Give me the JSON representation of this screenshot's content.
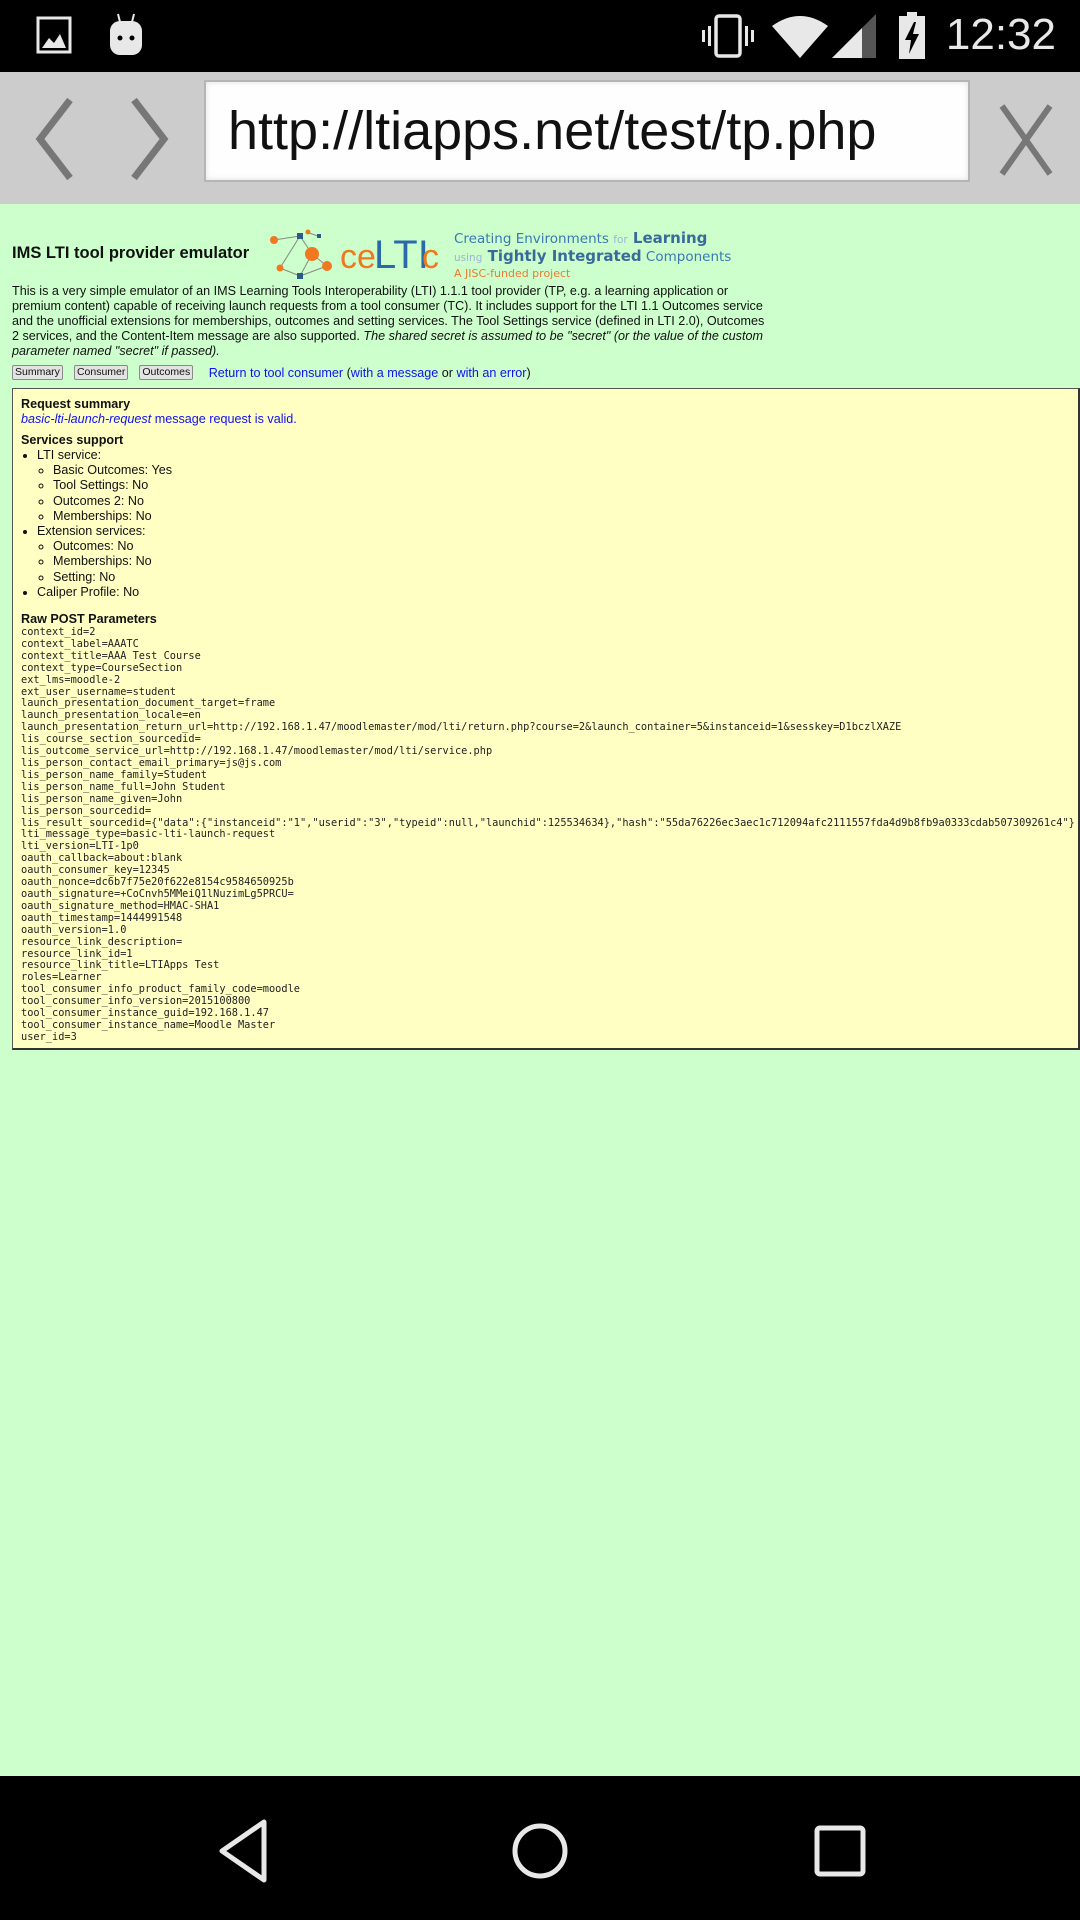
{
  "status_bar": {
    "left_icons": [
      "image-notification-icon",
      "android-notification-icon"
    ],
    "right_icons": [
      "vibrate-icon",
      "wifi-icon",
      "cell-signal-icon",
      "battery-charging-icon"
    ],
    "time": "12:32"
  },
  "browser": {
    "back_icon": "chevron-left-icon",
    "forward_icon": "chevron-right-icon",
    "url": "http://ltiapps.net/test/tp.php",
    "close_icon": "close-icon"
  },
  "page": {
    "title": "IMS LTI tool provider emulator",
    "logo": {
      "name": "ceLTIc",
      "tagline_line1_a": "Creating Environments ",
      "tagline_line1_b": "for",
      "tagline_line1_c": " Learning",
      "tagline_line2_a": "using",
      "tagline_line2_b": " Tightly Integrated",
      "tagline_line2_c": " Components",
      "tagline_line3": "A JISC-funded project"
    },
    "intro_text": "This is a very simple emulator of an IMS Learning Tools Interoperability (LTI) 1.1.1 tool provider (TP, e.g. a learning application or premium content) capable of receiving launch requests from a tool consumer (TC). It includes support for the LTI 1.1 Outcomes service and the unofficial extensions for memberships, outcomes and setting services. The Tool Settings service (defined in LTI 2.0), Outcomes 2 services, and the Content-Item message are also supported. ",
    "intro_italic": "The shared secret is assumed to be \"secret\" (or the value of the custom parameter named \"secret\" if passed).",
    "buttons": {
      "summary": "Summary",
      "consumer": "Consumer",
      "outcomes": "Outcomes"
    },
    "return_link": "Return to tool consumer",
    "paren_open": " (",
    "with_message_link": "with a message",
    "or_text": " or ",
    "with_error_link": "with an error",
    "paren_close": ")"
  },
  "summary": {
    "heading": "Request summary",
    "message_type": "basic-lti-launch-request",
    "valid_text": " message request is valid.",
    "services_heading": "Services support",
    "services": [
      {
        "label": "LTI service:",
        "items": [
          "Basic Outcomes: Yes",
          "Tool Settings: No",
          "Outcomes 2: No",
          "Memberships: No"
        ]
      },
      {
        "label": "Extension services:",
        "items": [
          "Outcomes: No",
          "Memberships: No",
          "Setting: No"
        ]
      },
      {
        "label": "Caliper Profile: No",
        "items": []
      }
    ],
    "raw_heading": "Raw POST Parameters",
    "raw_params": [
      "context_id=2",
      "context_label=AAATC",
      "context_title=AAA Test Course",
      "context_type=CourseSection",
      "ext_lms=moodle-2",
      "ext_user_username=student",
      "launch_presentation_document_target=frame",
      "launch_presentation_locale=en",
      "launch_presentation_return_url=http://192.168.1.47/moodlemaster/mod/lti/return.php?course=2&launch_container=5&instanceid=1&sesskey=D1bczlXAZE",
      "lis_course_section_sourcedid=",
      "lis_outcome_service_url=http://192.168.1.47/moodlemaster/mod/lti/service.php",
      "lis_person_contact_email_primary=js@js.com",
      "lis_person_name_family=Student",
      "lis_person_name_full=John Student",
      "lis_person_name_given=John",
      "lis_person_sourcedid=",
      "lis_result_sourcedid={\"data\":{\"instanceid\":\"1\",\"userid\":\"3\",\"typeid\":null,\"launchid\":125534634},\"hash\":\"55da76226ec3aec1c712094afc2111557fda4d9b8fb9a0333cdab507309261c4\"}",
      "lti_message_type=basic-lti-launch-request",
      "lti_version=LTI-1p0",
      "oauth_callback=about:blank",
      "oauth_consumer_key=12345",
      "oauth_nonce=dc6b7f75e20f622e8154c9584650925b",
      "oauth_signature=+CoCnvh5MMeiQ1lNuzimLg5PRCU=",
      "oauth_signature_method=HMAC-SHA1",
      "oauth_timestamp=1444991548",
      "oauth_version=1.0",
      "resource_link_description=",
      "resource_link_id=1",
      "resource_link_title=LTIApps Test",
      "roles=Learner",
      "tool_consumer_info_product_family_code=moodle",
      "tool_consumer_info_version=2015100800",
      "tool_consumer_instance_guid=192.168.1.47",
      "tool_consumer_instance_name=Moodle Master",
      "user_id=3"
    ]
  },
  "nav_bar": {
    "back": "back-triangle-icon",
    "home": "home-circle-icon",
    "recents": "recents-square-icon"
  },
  "colors": {
    "page_background": "#ccffcc",
    "panel_background": "#ffffc4",
    "link": "#1111ee",
    "logo_orange": "#f07830",
    "logo_blue": "#3a6a9a"
  }
}
